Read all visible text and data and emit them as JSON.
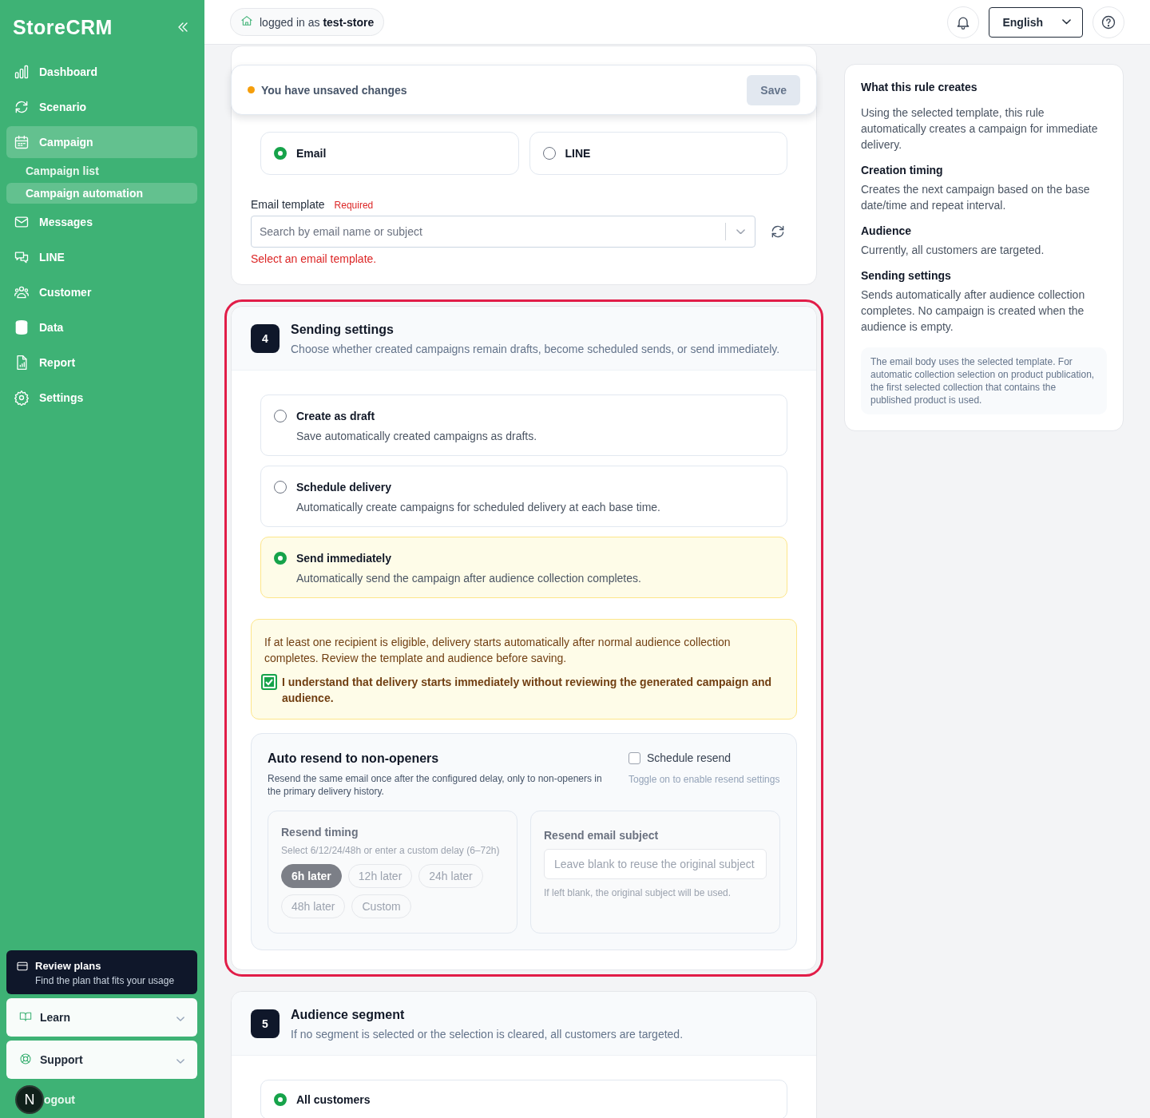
{
  "sidebar": {
    "logo": "StoreCRM",
    "nav": [
      {
        "label": "Dashboard",
        "selected": false
      },
      {
        "label": "Scenario",
        "selected": false
      },
      {
        "label": "Campaign",
        "selected": true,
        "children": [
          {
            "label": "Campaign list",
            "selected": false
          },
          {
            "label": "Campaign automation",
            "selected": true
          }
        ]
      },
      {
        "label": "Messages",
        "selected": false
      },
      {
        "label": "LINE",
        "selected": false
      },
      {
        "label": "Customer",
        "selected": false
      },
      {
        "label": "Data",
        "selected": false
      },
      {
        "label": "Report",
        "selected": false
      },
      {
        "label": "Settings",
        "selected": false
      }
    ],
    "promo": {
      "title": "Review plans",
      "subtitle": "Find the plan that fits your usage"
    },
    "menus": [
      {
        "label": "Learn",
        "expanded": false
      },
      {
        "label": "Support",
        "expanded": false
      }
    ],
    "avatar": "N",
    "logout": "ogout"
  },
  "header": {
    "login": "logged in as **test-store**",
    "language": "English"
  },
  "unsaved_bar": {
    "message": "You have unsaved changes",
    "save": "Save",
    "disabled": true
  },
  "channel_card": {
    "channels": [
      {
        "label": "Email",
        "selected": true
      },
      {
        "label": "LINE",
        "selected": false
      }
    ],
    "template_label": "Email template",
    "required": "Required",
    "placeholder": "Search by email name or subject",
    "error": "Select an email template."
  },
  "sending_card": {
    "step": "4",
    "title": "Sending settings",
    "description": "Choose whether created campaigns remain drafts, become scheduled sends, or send immediately.",
    "focused": true,
    "options": [
      {
        "title": "Create as draft",
        "description": "Save automatically created campaigns as drafts.",
        "selected": false
      },
      {
        "title": "Schedule delivery",
        "description": "Automatically create campaigns for scheduled delivery at each base time.",
        "selected": false
      },
      {
        "title": "Send immediately",
        "description": "Automatically send the campaign after audience collection completes.",
        "selected": true
      }
    ],
    "warning": {
      "text": "If at least one recipient is eligible, delivery starts automatically after normal audience collection completes. Review the template and audience before saving.",
      "checkbox_label": "I understand that delivery starts immediately without reviewing the generated campaign and audience.",
      "checked": true
    },
    "resend": {
      "title": "Auto resend to non-openers",
      "description": "Resend the same email once after the configured delay, only to non-openers in the primary delivery history.",
      "toggle_label": "Schedule resend",
      "checked": false,
      "toggle_hint": "Toggle on to enable resend settings",
      "timing": {
        "title": "Resend timing",
        "hint": "Select 6/12/24/48h or enter a custom delay (6–72h)",
        "chips": [
          {
            "label": "6h later",
            "selected": true
          },
          {
            "label": "12h later",
            "selected": false
          },
          {
            "label": "24h later",
            "selected": false
          },
          {
            "label": "48h later",
            "selected": false
          },
          {
            "label": "Custom",
            "selected": false
          }
        ]
      },
      "subject": {
        "title": "Resend email subject",
        "placeholder": "Leave blank to reuse the original subject",
        "hint": "If left blank, the original subject will be used."
      }
    }
  },
  "audience_card": {
    "step": "5",
    "title": "Audience segment",
    "description": "If no segment is selected or the selection is cleared, all customers are targeted.",
    "options": [
      {
        "title": "All customers",
        "selected": true
      }
    ]
  },
  "summary": {
    "title": "What this rule creates",
    "intro": "Using the selected template, this rule automatically creates a campaign for immediate delivery.",
    "sections": [
      {
        "title": "Creation timing",
        "text": "Creates the next campaign based on the base date/time and repeat interval."
      },
      {
        "title": "Audience",
        "text": "Currently, all customers are targeted."
      },
      {
        "title": "Sending settings",
        "text": "Sends automatically after audience collection completes. No campaign is created when the audience is empty."
      }
    ],
    "note": "The email body uses the selected template. For automatic collection selection on product publication, the first selected collection that contains the published product is used."
  }
}
